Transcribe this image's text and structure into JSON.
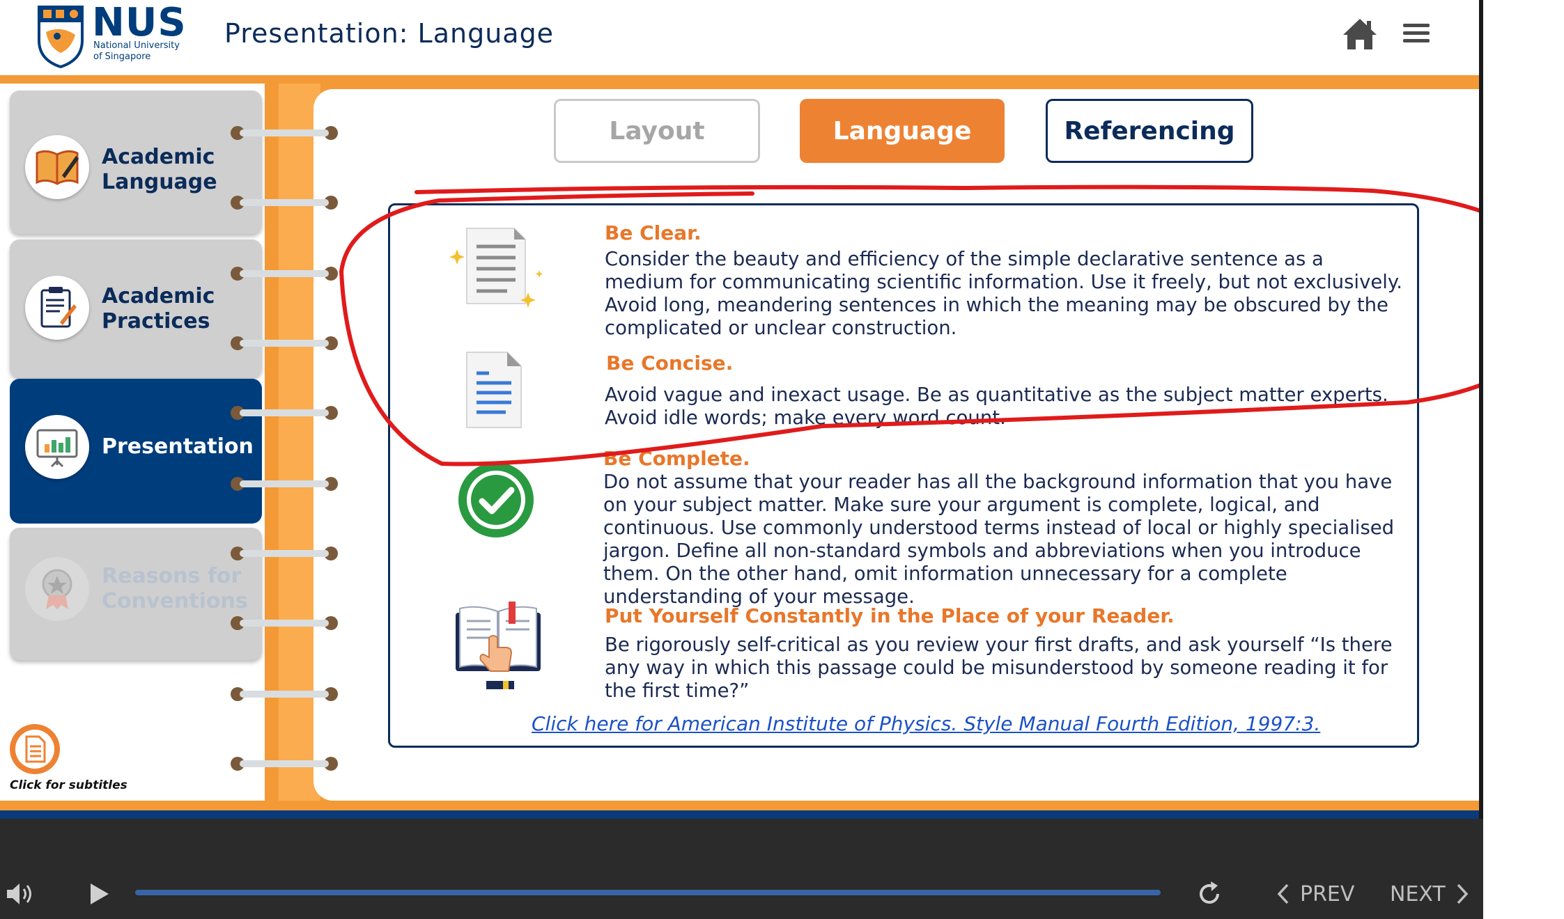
{
  "header": {
    "logo_text": "NUS",
    "logo_sub1": "National University",
    "logo_sub2": "of Singapore",
    "page_title": "Presentation: Language"
  },
  "sidebar": {
    "items": [
      {
        "label": "Academic\nLanguage",
        "state": "normal",
        "icon": "book-pen-icon"
      },
      {
        "label": "Academic\nPractices",
        "state": "normal",
        "icon": "clipboard-icon"
      },
      {
        "label": "Presentation",
        "state": "active",
        "icon": "presentation-board-icon"
      },
      {
        "label": "Reasons for\nConventions",
        "state": "disabled",
        "icon": "award-medal-icon"
      }
    ]
  },
  "tabs": [
    {
      "label": "Layout",
      "state": "inactive"
    },
    {
      "label": "Language",
      "state": "active"
    },
    {
      "label": "Referencing",
      "state": "outlined"
    }
  ],
  "sections": [
    {
      "title": "Be Clear",
      "punct": ".",
      "body": "Consider the beauty and efficiency of the simple declarative sentence as a medium for communicating scientific information. Use it freely, but not exclusively. Avoid long, meandering sentences in which the meaning may be obscured by the complicated or unclear construction.",
      "icon": "sparkle-document-icon"
    },
    {
      "title": "Be Concise",
      "punct": ".",
      "body": "Avoid vague and inexact usage. Be as quantitative as the subject matter experts. Avoid idle words; make every word count.",
      "icon": "document-lines-icon"
    },
    {
      "title": "Be Complete.",
      "punct": "",
      "body": "Do not assume that your reader has all the background information that you have on your subject matter. Make sure your argument is complete, logical, and continuous. Use commonly understood terms instead of local or highly specialised jargon. Define all non-standard symbols and abbreviations when you introduce them. On the other hand, omit information unnecessary for a complete understanding of your message.",
      "icon": "checkmark-circle-icon"
    },
    {
      "title": "Put Yourself Constantly in the Place of your Reader",
      "punct": ".",
      "body": "Be rigorously self-critical as you review your first drafts, and ask yourself “Is there any way in which this passage could be misunderstood by someone reading it for the first time?”",
      "icon": "book-reading-hand-icon"
    }
  ],
  "reference_link": "Click here for American Institute of Physics. Style Manual Fourth Edition, 1997:3.",
  "subtitles_label": "Click for subtitles",
  "player": {
    "prev_label": "PREV",
    "next_label": "NEXT"
  },
  "colors": {
    "brand_blue": "#003d7c",
    "orange": "#ee8233",
    "annotation_red": "#e01b1b"
  }
}
